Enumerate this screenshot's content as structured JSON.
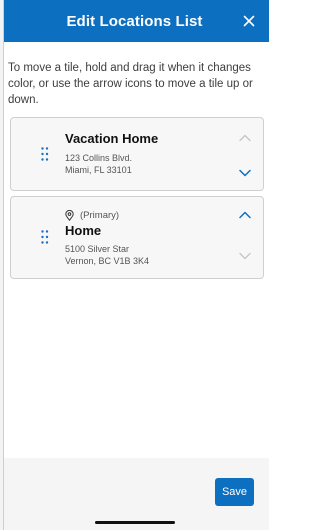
{
  "header": {
    "title": "Edit Locations List",
    "close_icon": "close-icon"
  },
  "instructions": "To move a tile, hold and drag it when it changes color, or use the arrow icons to move a tile up or down.",
  "locations": [
    {
      "name": "Vacation Home",
      "address_line1": "123 Collins Blvd.",
      "address_line2": "Miami, FL 33101",
      "primary": false,
      "move_up_enabled": false,
      "move_down_enabled": true
    },
    {
      "name": "Home",
      "primary_label": "(Primary)",
      "address_line1": "5100 Silver Star",
      "address_line2": "Vernon, BC V1B 3K4",
      "primary": true,
      "move_up_enabled": true,
      "move_down_enabled": false
    }
  ],
  "footer": {
    "save_label": "Save"
  },
  "colors": {
    "brand_blue": "#0d6fc0",
    "arrow_enabled": "#0d6fc0",
    "arrow_disabled": "#c4c4c4",
    "tile_background": "#f7f7f7",
    "footer_background": "#f5f5f5"
  }
}
